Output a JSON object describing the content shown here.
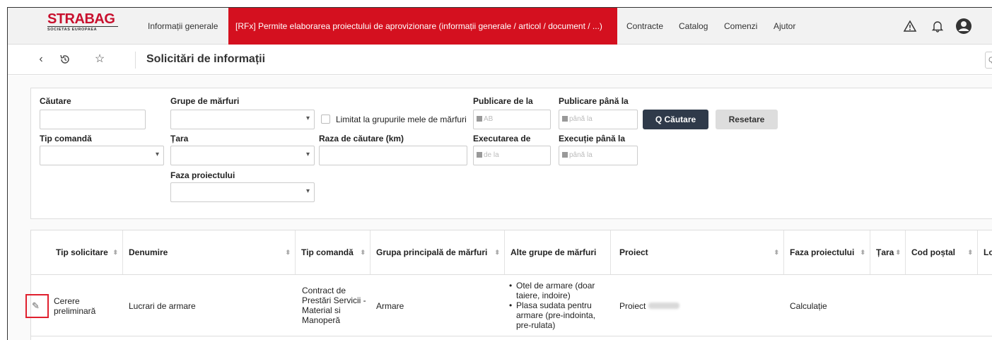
{
  "logo": {
    "main": "STRABAG",
    "sub": "SOCIETAS EUROPAEA"
  },
  "nav": {
    "items": [
      "Informații generale",
      "[RFx] Permite elaborarea proiectului de aprovizionare (informații generale / articol / document / ...)",
      "Contracte",
      "Catalog",
      "Comenzi",
      "Ajutor"
    ]
  },
  "subheader": {
    "title": "Solicitări de informații",
    "search_hint": "Q"
  },
  "filters": {
    "cautare": "Căutare",
    "grupe": "Grupe de mărfuri",
    "limitat": "Limitat la grupurile mele de mărfuri",
    "publicare_de_la": "Publicare de la",
    "publicare_de_la_ph": "AB",
    "publicare_pana_la": "Publicare până la",
    "publicare_pana_la_ph": "până la",
    "tip_comanda": "Tip comandă",
    "tara": "Țara",
    "raza": "Raza de căutare (km)",
    "executarea_de": "Executarea de",
    "executarea_de_ph": "de la",
    "executie_pana_la": "Execuție până la",
    "executie_pana_la_ph": "până la",
    "faza": "Faza proiectului",
    "search_btn": "Q Căutare",
    "reset_btn": "Resetare"
  },
  "table": {
    "headers": [
      "Tip solicitare",
      "Denumire",
      "Tip comandă",
      "Grupa principală de mărfuri",
      "Alte grupe de mărfuri",
      "Proiect",
      "Faza proiectului",
      "Țara",
      "Cod poștal",
      "Lo"
    ],
    "row": {
      "tip_solicitare_1": "Cerere",
      "tip_solicitare_2": "preliminară",
      "denumire": "Lucrari de armare",
      "tip_comanda": [
        "Contract de",
        "Prestări Servicii -",
        "Material si",
        "Manoperă"
      ],
      "grupa": "Armare",
      "alte_grupe": [
        "Otel de armare (doar taiere, indoire)",
        "Plasa sudata pentru armare (pre-indointa, pre-rulata)"
      ],
      "proiect": "Proiect",
      "faza": "Calculație"
    }
  }
}
